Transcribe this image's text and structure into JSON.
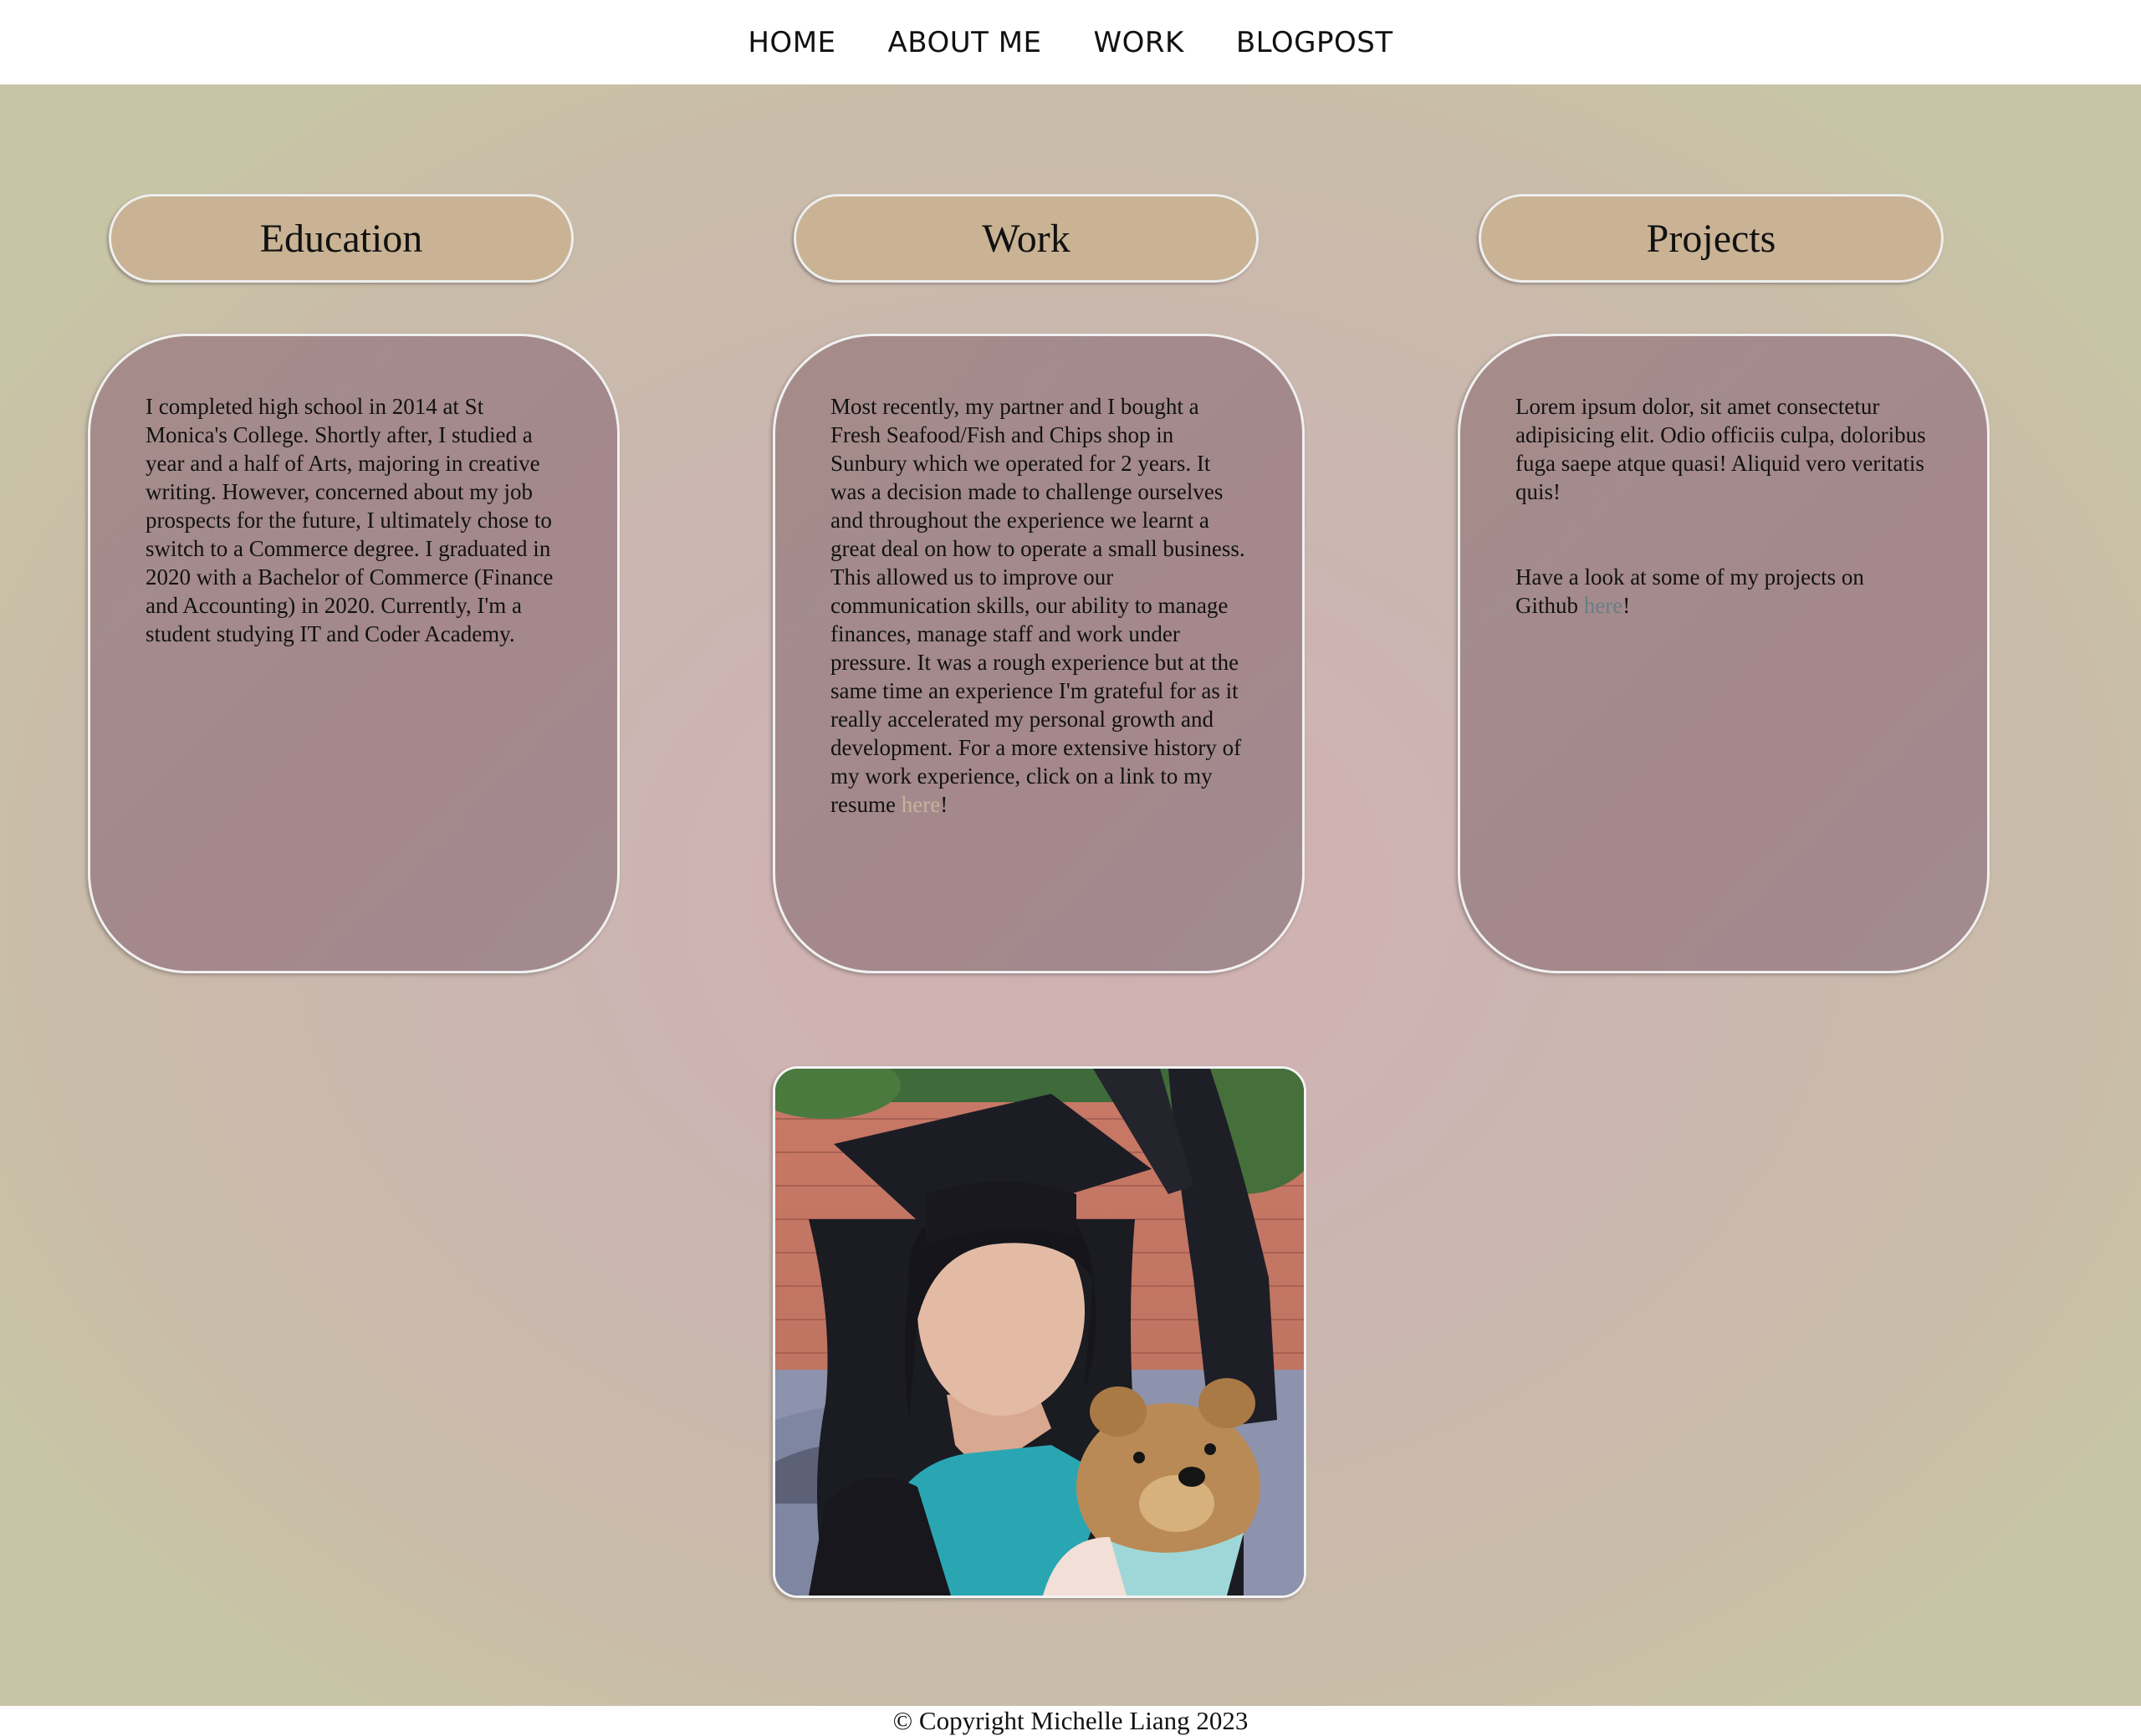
{
  "nav": {
    "items": [
      {
        "label": "HOME"
      },
      {
        "label": "ABOUT ME"
      },
      {
        "label": "WORK"
      },
      {
        "label": "BLOGPOST"
      }
    ]
  },
  "sections": {
    "education": {
      "heading": "Education",
      "text": "I completed high school in 2014 at St Monica's College. Shortly after, I studied a year and a half of Arts, majoring in creative writing. However, concerned about my job prospects for the future, I ultimately chose to switch to a Commerce degree. I graduated in 2020 with a Bachelor of Commerce (Finance and Accounting) in 2020. Currently, I'm a student studying IT and Coder Academy."
    },
    "work": {
      "heading": "Work",
      "text": "Most recently, my partner and I bought a Fresh Seafood/Fish and Chips shop in Sunbury which we operated for 2 years. It was a decision made to challenge ourselves and throughout the experience we learnt a great deal on how to operate a small business. This allowed us to improve our communication skills, our ability to manage finances, manage staff and work under pressure. It was a rough experience but at the same time an experience I'm grateful for as it really accelerated my personal growth and development. For a more extensive history of my work experience, click on a link to my resume ",
      "link_label": "here",
      "text_end": "!"
    },
    "projects": {
      "heading": "Projects",
      "text": "Lorem ipsum dolor, sit amet consectetur adipisicing elit. Odio officiis culpa, doloribus fuga saepe atque quasi! Aliquid vero veritatis quis!",
      "text2": "Have a look at some of my projects on Github ",
      "link_label": "here",
      "text2_end": "!"
    }
  },
  "footer": {
    "text": "© Copyright Michelle Liang 2023"
  }
}
